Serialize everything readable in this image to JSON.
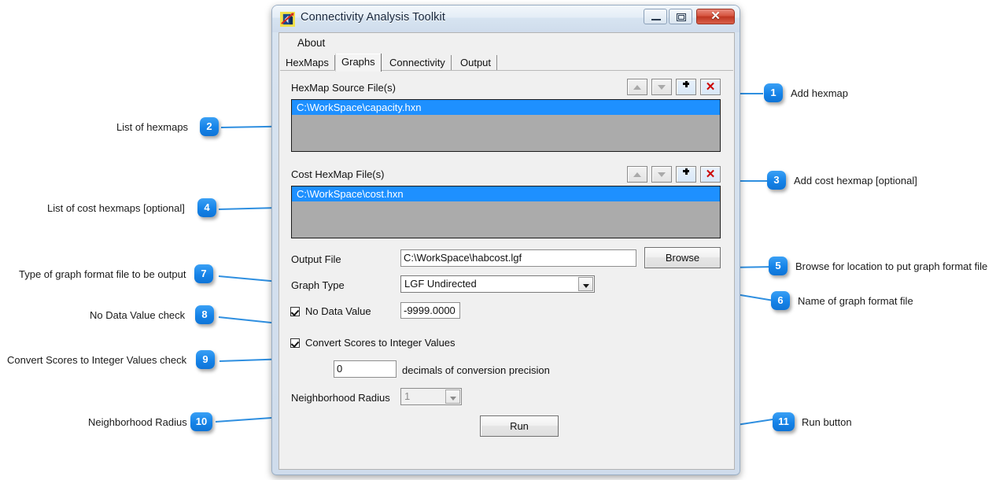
{
  "window": {
    "title": "Connectivity Analysis Toolkit",
    "icon": "app-icon",
    "controls": {
      "minimize": "minimize-button",
      "maximize": "maximize-button",
      "close": "close-button",
      "close_glyph": "✕"
    }
  },
  "menu": {
    "about": "About"
  },
  "tabs": [
    {
      "label": "HexMaps",
      "selected": false
    },
    {
      "label": "Graphs",
      "selected": true
    },
    {
      "label": "Connectivity",
      "selected": false
    },
    {
      "label": "Output",
      "selected": false
    }
  ],
  "form": {
    "hexmap_source_label": "HexMap Source File(s)",
    "hexmap_source_items": [
      "C:\\WorkSpace\\capacity.hxn"
    ],
    "cost_hexmap_label": "Cost HexMap File(s)",
    "cost_hexmap_items": [
      "C:\\WorkSpace\\cost.hxn"
    ],
    "output_file_label": "Output File",
    "output_file_value": "C:\\WorkSpace\\habcost.lgf",
    "browse_label": "Browse",
    "graph_type_label": "Graph Type",
    "graph_type_value": "LGF Undirected",
    "no_data_value_label": "No Data Value",
    "no_data_value_checked": true,
    "no_data_value_value": "-9999.0000",
    "convert_scores_label": "Convert Scores to Integer Values",
    "convert_scores_checked": true,
    "precision_value": "0",
    "precision_label": "decimals of conversion precision",
    "neighborhood_radius_label": "Neighborhood Radius",
    "neighborhood_radius_value": "1",
    "run_label": "Run"
  },
  "toolbar_icons": {
    "move_up": "chevron-up-icon",
    "move_down": "chevron-down-icon",
    "add": "plus-icon",
    "remove": "red-x-icon"
  },
  "callouts": [
    {
      "num": "1",
      "text": "Add hexmap"
    },
    {
      "num": "2",
      "text": "List of hexmaps"
    },
    {
      "num": "3",
      "text": "Add cost hexmap [optional]"
    },
    {
      "num": "4",
      "text": "List of cost hexmaps [optional]"
    },
    {
      "num": "5",
      "text": "Browse for location to put graph format file"
    },
    {
      "num": "6",
      "text": "Name of graph format file"
    },
    {
      "num": "7",
      "text": "Type of graph format file to be output"
    },
    {
      "num": "8",
      "text": "No Data Value check"
    },
    {
      "num": "9",
      "text": "Convert Scores to Integer Values check"
    },
    {
      "num": "10",
      "text": "Neighborhood Radius"
    },
    {
      "num": "11",
      "text": "Run button"
    }
  ],
  "colors": {
    "badge": "#1583e8",
    "leader": "#2f8fe0",
    "selection": "#1e90ff",
    "listbox_bg": "#ababab"
  }
}
